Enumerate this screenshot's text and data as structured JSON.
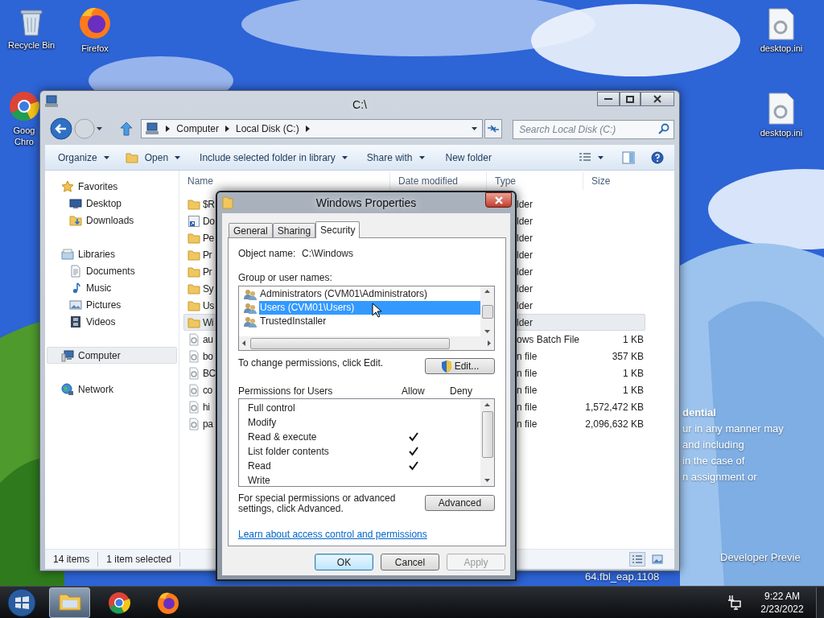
{
  "desktop": {
    "icons": [
      {
        "label": "Recycle Bin",
        "kind": "recycle-bin"
      },
      {
        "label": "Firefox",
        "kind": "firefox"
      },
      {
        "label": "desktop.ini",
        "kind": "settings-file"
      },
      {
        "label": "Goog Chro",
        "kind": "chrome"
      },
      {
        "label": "desktop.ini",
        "kind": "settings-file"
      }
    ],
    "notice_lines": [
      "dential",
      "ur in any manner may",
      "and including",
      "in the case of",
      "n assignment or"
    ],
    "build_lines": [
      "Developer Previe",
      "64.fbl_eap.1108"
    ]
  },
  "explorer": {
    "title": "C:\\",
    "breadcrumb": [
      "Computer",
      "Local Disk (C:)"
    ],
    "search": {
      "placeholder": "Search Local Disk (C:)"
    },
    "toolbar": [
      {
        "label": "Organize",
        "dropdown": true,
        "kind": "text"
      },
      {
        "label": "Open",
        "dropdown": true,
        "kind": "open"
      },
      {
        "label": "Include selected folder in library",
        "dropdown": true,
        "kind": "text"
      },
      {
        "label": "Share with",
        "dropdown": true,
        "kind": "text"
      },
      {
        "label": "New folder",
        "dropdown": false,
        "kind": "text"
      }
    ],
    "nav": [
      {
        "label": "Favorites",
        "kind": "favorites",
        "selected": false,
        "children": [
          {
            "label": "Desktop",
            "kind": "desktop",
            "selected": false
          },
          {
            "label": "Downloads",
            "kind": "downloads",
            "selected": false
          }
        ]
      },
      {
        "label": "Libraries",
        "kind": "libraries",
        "selected": false,
        "children": [
          {
            "label": "Documents",
            "kind": "documents",
            "selected": false
          },
          {
            "label": "Music",
            "kind": "music",
            "selected": false
          },
          {
            "label": "Pictures",
            "kind": "pictures",
            "selected": false
          },
          {
            "label": "Videos",
            "kind": "videos",
            "selected": false
          }
        ]
      },
      {
        "label": "Computer",
        "kind": "computer",
        "selected": true
      },
      {
        "label": "Network",
        "kind": "network",
        "selected": false
      }
    ],
    "columns": [
      "Name",
      "Date modified",
      "Type",
      "Size"
    ],
    "rows": [
      {
        "name": "$R",
        "kind": "folder",
        "type": "lder",
        "selected": false
      },
      {
        "name": "Do",
        "kind": "shortcut",
        "type": "lder",
        "selected": false
      },
      {
        "name": "Pe",
        "kind": "folder",
        "type": "lder",
        "selected": false
      },
      {
        "name": "Pr",
        "kind": "folder",
        "type": "lder",
        "selected": false
      },
      {
        "name": "Pr",
        "kind": "folder",
        "type": "lder",
        "selected": false
      },
      {
        "name": "Sy",
        "kind": "folder",
        "type": "lder",
        "selected": false
      },
      {
        "name": "Us",
        "kind": "folder",
        "type": "lder",
        "selected": false
      },
      {
        "name": "Wi",
        "kind": "folder",
        "type": "lder",
        "selected": true
      },
      {
        "name": "au",
        "kind": "file",
        "type": "ows Batch File",
        "size": "1 KB",
        "selected": false
      },
      {
        "name": "bo",
        "kind": "file",
        "type": "n file",
        "size": "357 KB",
        "selected": false
      },
      {
        "name": "BC",
        "kind": "file",
        "type": "n file",
        "size": "1 KB",
        "selected": false
      },
      {
        "name": "co",
        "kind": "file",
        "type": "n file",
        "size": "1 KB",
        "selected": false
      },
      {
        "name": "hi",
        "kind": "file",
        "type": "n file",
        "size": "1,572,472 KB",
        "selected": false
      },
      {
        "name": "pa",
        "kind": "file",
        "type": "n file",
        "size": "2,096,632 KB",
        "selected": false
      }
    ],
    "status": {
      "count": "14 items",
      "selection": "1 item selected"
    }
  },
  "dialog": {
    "title": "Windows Properties",
    "tabs": [
      {
        "label": "General",
        "selected": false
      },
      {
        "label": "Sharing",
        "selected": false
      },
      {
        "label": "Security",
        "selected": true
      }
    ],
    "object_label": "Object name:",
    "object_value": "C:\\Windows",
    "group_label": "Group or user names:",
    "groups": [
      {
        "label": "Administrators (CVM01\\Administrators)",
        "selected": false
      },
      {
        "label": "Users (CVM01\\Users)",
        "selected": true
      },
      {
        "label": "TrustedInstaller",
        "selected": false
      }
    ],
    "edit_hint": "To change permissions, click Edit.",
    "edit_button": "Edit...",
    "permissions_label": "Permissions for Users",
    "allow_label": "Allow",
    "deny_label": "Deny",
    "permissions": [
      {
        "label": "Full control",
        "allow": false,
        "deny": false
      },
      {
        "label": "Modify",
        "allow": false,
        "deny": false
      },
      {
        "label": "Read & execute",
        "allow": true,
        "deny": false
      },
      {
        "label": "List folder contents",
        "allow": true,
        "deny": false
      },
      {
        "label": "Read",
        "allow": true,
        "deny": false
      },
      {
        "label": "Write",
        "allow": false,
        "deny": false
      }
    ],
    "advanced_hint": "For special permissions or advanced settings, click Advanced.",
    "advanced_button": "Advanced",
    "link": "Learn about access control and permissions",
    "buttons": [
      {
        "label": "OK",
        "default": true,
        "disabled": false
      },
      {
        "label": "Cancel",
        "default": false,
        "disabled": false
      },
      {
        "label": "Apply",
        "default": false,
        "disabled": true
      }
    ]
  },
  "taskbar": {
    "apps": [
      {
        "kind": "explorer",
        "active": true
      },
      {
        "kind": "chrome",
        "active": false
      },
      {
        "kind": "firefox",
        "active": false
      }
    ],
    "time": "9:22 AM",
    "date": "2/23/2022"
  }
}
